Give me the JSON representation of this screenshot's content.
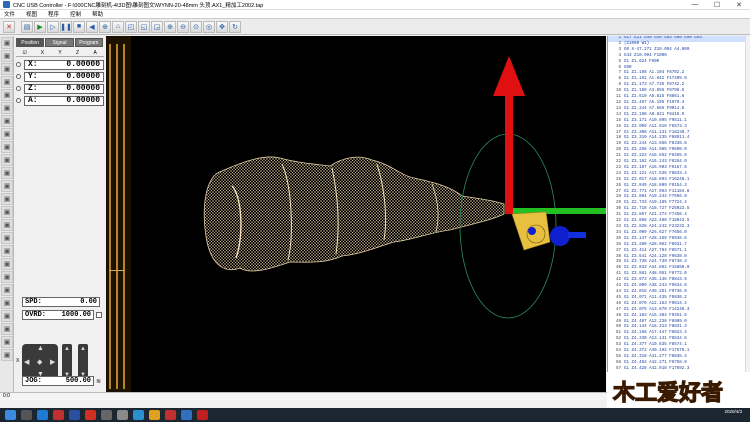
{
  "window": {
    "title": "CNC USB Controller - F:\\000CNC雕刻机-4\\3D图\\雕刻图文\\WYNN-20-48mm 头顶.AX1_精加工2002.tap",
    "minimize": "—",
    "maximize": "☐",
    "close": "✕"
  },
  "menu": [
    "文件",
    "视图",
    "程序",
    "控制",
    "帮助"
  ],
  "tabs": [
    "Position",
    "Signal",
    "Program"
  ],
  "coord_headers": [
    "",
    "X",
    "Y",
    "Z",
    "A"
  ],
  "axes": [
    {
      "label": "X:",
      "value": "0.00000"
    },
    {
      "label": "Y:",
      "value": "0.00000"
    },
    {
      "label": "Z:",
      "value": "0.00000"
    },
    {
      "label": "A:",
      "value": "0.00000"
    }
  ],
  "spd": {
    "label": "SPD:",
    "value": "0.00"
  },
  "ovrd": {
    "label": "OVRD:",
    "value": "1000.00"
  },
  "jog": {
    "label": "JOG:",
    "value": "500.00"
  },
  "jog_keys": {
    "left": "◀",
    "right": "▶",
    "up": "▲",
    "down": "▼",
    "center": "◆",
    "x_label": "X",
    "z_label": "Z",
    "a_label": "A"
  },
  "gcode": [
    {
      "n": "1",
      "t": "G17 G21 G40 G49 G54 G80 G90 G94"
    },
    {
      "n": "2",
      "t": "(G1000 W1)"
    },
    {
      "n": "3",
      "t": "G0 X-47.271 Z10.094 A4.000"
    },
    {
      "n": "4",
      "t": "G43 Z10.094 F1000"
    },
    {
      "n": "5",
      "t": "G1 Z1.624 F600"
    },
    {
      "n": "6",
      "t": "G90"
    },
    {
      "n": "7",
      "t": "G1 Z1.198 A1.104 F8702.2"
    },
    {
      "n": "8",
      "t": "G1 Z1.191 A1.842 F17495.9"
    },
    {
      "n": "9",
      "t": "G1 Z1.173 A7.735 F8742.2"
    },
    {
      "n": "10",
      "t": "G1 Z1.169 A3.655 F8796.6"
    },
    {
      "n": "11",
      "t": "G1 Z2.610 A5.815 F8861.6"
    },
    {
      "n": "12",
      "t": "G1 Z2.467 A5.195 F1979.3"
    },
    {
      "n": "13",
      "t": "G1 Z2.244 A7.685 F9014.8"
    },
    {
      "n": "14",
      "t": "G1 Z3.168 A8.831 F8416.9"
    },
    {
      "n": "15",
      "t": "G1 Z3.171 A10.095 F9511.1"
    },
    {
      "n": "16",
      "t": "G1 Z3.099 A11.016 F6573.3"
    },
    {
      "n": "17",
      "t": "G1 Z3.308 A11.131 F18238.7"
    },
    {
      "n": "18",
      "t": "G1 Z3.310 A14.235 F88911.4"
    },
    {
      "n": "19",
      "t": "G1 Z3.244 A13.666 F8336.8"
    },
    {
      "n": "20",
      "t": "G1 Z3.258 A14.985 F9690.0"
    },
    {
      "n": "21",
      "t": "G1 Z3.223 A15.652 F6465.8"
    },
    {
      "n": "22",
      "t": "G1 Z3.162 A16.243 F8264.0"
    },
    {
      "n": "23",
      "t": "G1 Z3.187 A16.903 F9167.8"
    },
    {
      "n": "24",
      "t": "G1 Z3.121 A17.536 F8833.4"
    },
    {
      "n": "25",
      "t": "G1 Z3.017 A18.893 F16248.1"
    },
    {
      "n": "26",
      "t": "G1 Z2.849 A18.809 F9154.3"
    },
    {
      "n": "27",
      "t": "G1 Z2.771 A17.963 F11184.8"
    },
    {
      "n": "28",
      "t": "G1 Z2.804 A19.244 F7666.0"
    },
    {
      "n": "29",
      "t": "G1 Z2.733 A19.185 F7724.4"
    },
    {
      "n": "30",
      "t": "G1 Z2.716 A18.727 F25023.5"
    },
    {
      "n": "31",
      "t": "G1 Z2.857 A21.374 F7456.4"
    },
    {
      "n": "32",
      "t": "G1 Z2.868 A23.488 F16043.5"
    },
    {
      "n": "33",
      "t": "G1 Z2.828 A24.242 F23232.3"
    },
    {
      "n": "34",
      "t": "G1 Z3.009 A26.627 F7656.0"
    },
    {
      "n": "35",
      "t": "G1 Z3.147 A28.159 F6936.6"
    },
    {
      "n": "36",
      "t": "G1 Z3.280 A28.062 F8931.7"
    },
    {
      "n": "37",
      "t": "G1 Z3.414 A27.784 F8571.1"
    },
    {
      "n": "38",
      "t": "G1 Z3.541 A24.128 F9638.8"
    },
    {
      "n": "39",
      "t": "G1 Z3.738 A24.739 F8738.3"
    },
    {
      "n": "40",
      "t": "G1 Z3.833 A34.862 F15858.0"
    },
    {
      "n": "41",
      "t": "G1 Z3.861 A48.051 F8772.0"
    },
    {
      "n": "42",
      "t": "G1 Z3.973 A35.146 F8843.9"
    },
    {
      "n": "43",
      "t": "G1 Z4.009 A38.243 F9634.8"
    },
    {
      "n": "44",
      "t": "G1 Z4.015 A39.251 F9736.8"
    },
    {
      "n": "45",
      "t": "G1 Z4.071 A11.435 F9830.2"
    },
    {
      "n": "46",
      "t": "G1 Z4.079 A12.153 F9814.4"
    },
    {
      "n": "47",
      "t": "G1 Z4.075 A13.870 F14240.3"
    },
    {
      "n": "48",
      "t": "G1 Z4.183 A15.384 F9451.6"
    },
    {
      "n": "49",
      "t": "G1 Z4.487 A12.238 F8989.0"
    },
    {
      "n": "50",
      "t": "G1 Z4.144 A16.313 F8831.3"
    },
    {
      "n": "51",
      "t": "G1 Z4.168 A17.447 F8823.4"
    },
    {
      "n": "52",
      "t": "G1 Z4.330 A13.141 F8534.6"
    },
    {
      "n": "53",
      "t": "G1 Z4.377 A19.835 F8574.1"
    },
    {
      "n": "54",
      "t": "G1 Z4.372 A40.192 F17575.1"
    },
    {
      "n": "55",
      "t": "G1 Z4.318 A41.277 F8835.4"
    },
    {
      "n": "56",
      "t": "G1 Z4.462 A42.271 F8758.9"
    },
    {
      "n": "57",
      "t": "G1 Z4.428 A42.918 F17692.3"
    }
  ],
  "status_text": "0:0",
  "logo": {
    "brand": "木工爱好者"
  },
  "clock": {
    "time": "",
    "date": "2020/4/3"
  },
  "colors": {
    "z_arrow": "#e01010",
    "y_arrow": "#22c020",
    "a_marker": "#1020d0",
    "model": "#e8d0a0",
    "viewport_bg": "#000000"
  }
}
